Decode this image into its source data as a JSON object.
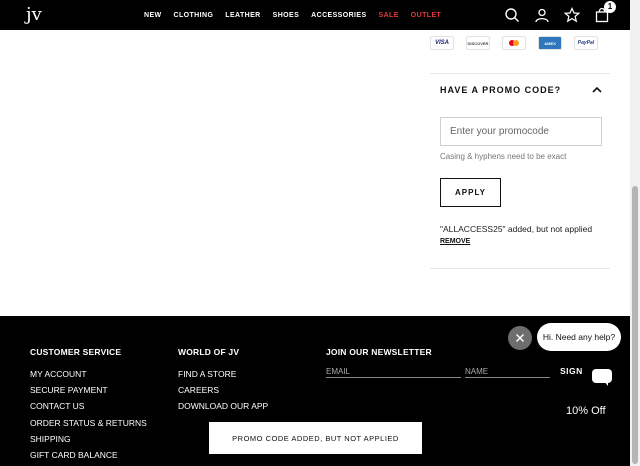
{
  "header": {
    "logo": "jv",
    "nav": [
      {
        "label": "NEW",
        "color": "#ffffff"
      },
      {
        "label": "CLOTHING",
        "color": "#ffffff"
      },
      {
        "label": "LEATHER",
        "color": "#ffffff"
      },
      {
        "label": "SHOES",
        "color": "#ffffff"
      },
      {
        "label": "ACCESSORIES",
        "color": "#ffffff"
      },
      {
        "label": "SALE",
        "color": "#e03a3a"
      },
      {
        "label": "OUTLET",
        "color": "#e03a3a"
      }
    ],
    "icons": [
      "search-icon",
      "account-icon",
      "wishlist-star-icon",
      "cart-bag-icon"
    ],
    "cart_count": "1"
  },
  "payments": {
    "visa": "VISA",
    "discover": "DISCOVER",
    "amex": "AMEX",
    "paypal": "PayPal"
  },
  "promo": {
    "title": "HAVE A PROMO CODE?",
    "input_placeholder": "Enter your promocode",
    "hint": "Casing & hyphens need to be exact",
    "apply_label": "APPLY",
    "status": "\"ALLACCESS25\" added, but not applied",
    "remove_label": "REMOVE"
  },
  "footer": {
    "customer_service": {
      "title": "CUSTOMER SERVICE",
      "links": [
        "MY ACCOUNT",
        "SECURE PAYMENT",
        "CONTACT US",
        "ORDER STATUS & RETURNS",
        "SHIPPING",
        "GIFT CARD BALANCE"
      ]
    },
    "world": {
      "title": "WORLD OF JV",
      "links": [
        "FIND A STORE",
        "CAREERS",
        "DOWNLOAD OUR APP"
      ]
    },
    "newsletter": {
      "title": "JOIN OUR NEWSLETTER",
      "email_placeholder": "EMAIL",
      "name_placeholder": "NAME",
      "signup_label": "SIGN"
    }
  },
  "chat": {
    "bubble_text": "Hi. Need any help?",
    "offer_text": "10% Off"
  },
  "toast": {
    "message": "PROMO CODE ADDED, BUT NOT APPLIED"
  }
}
